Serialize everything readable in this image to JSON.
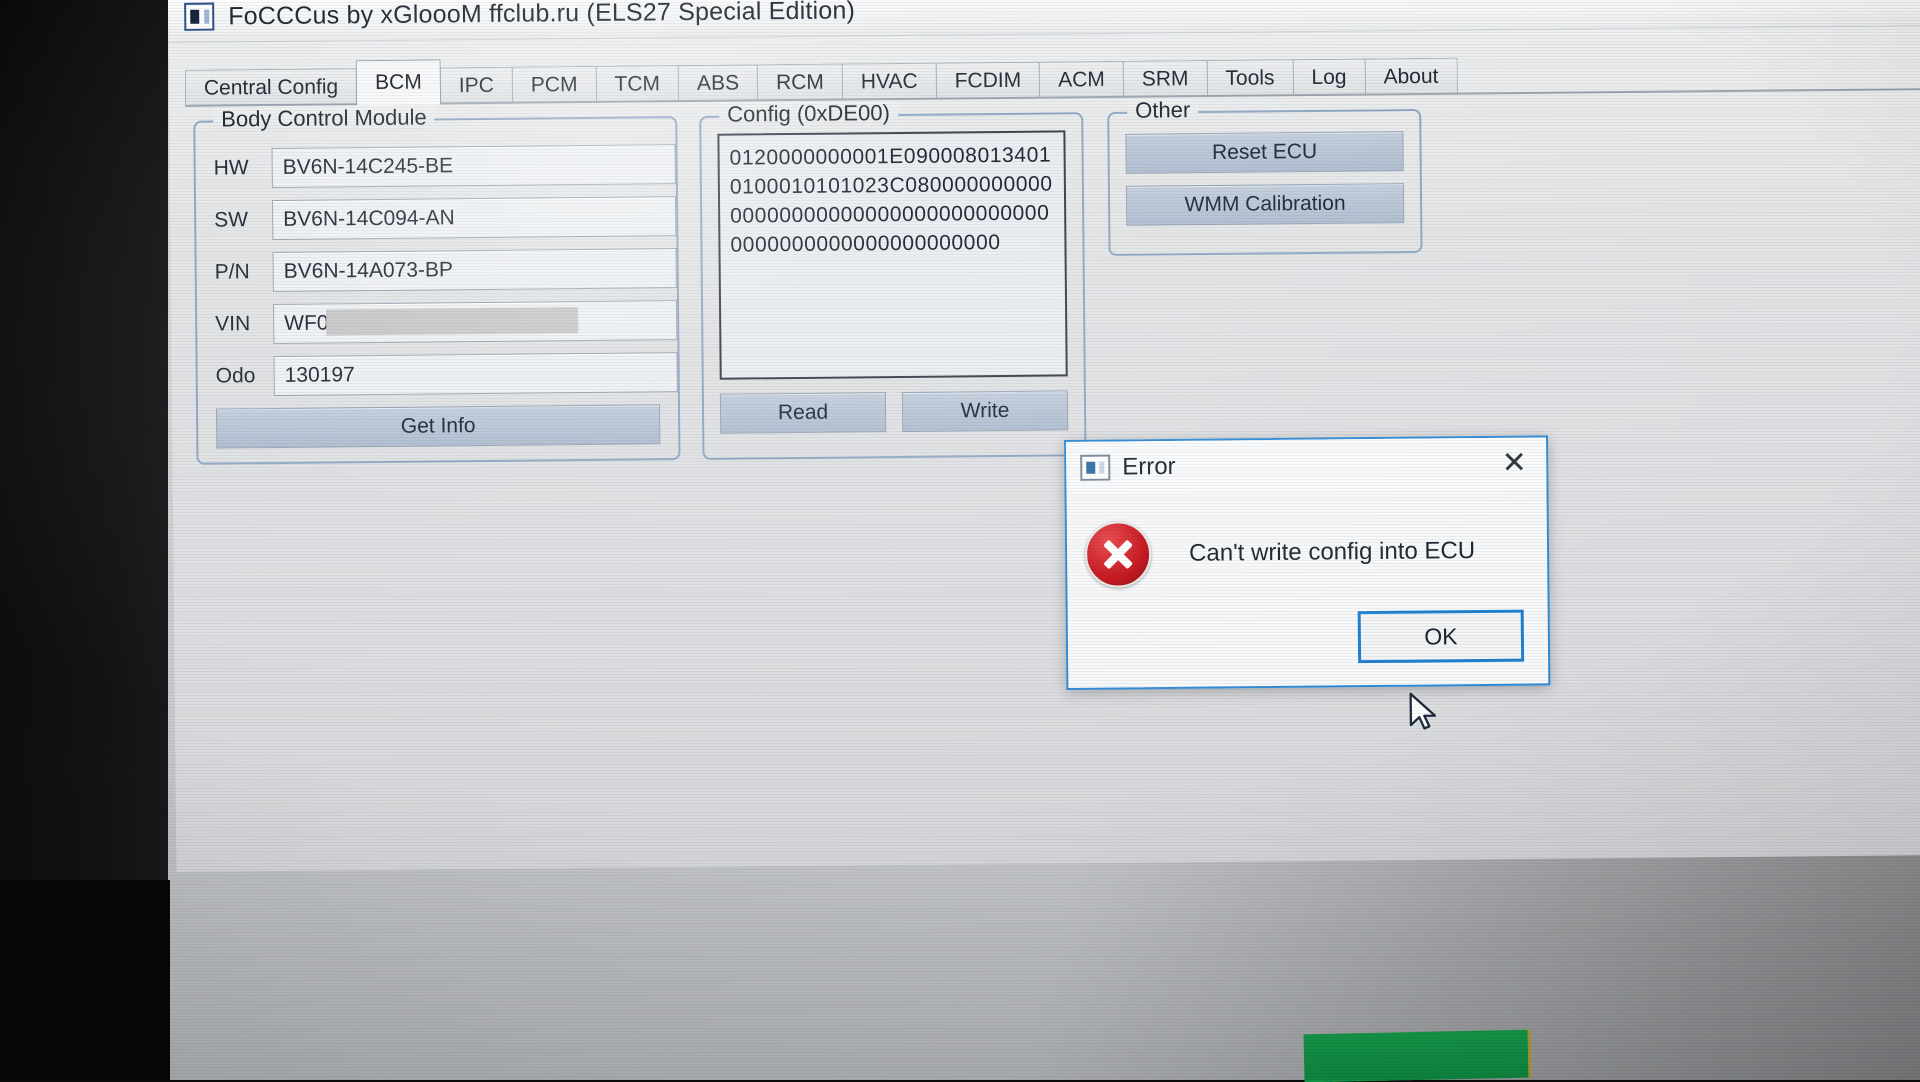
{
  "window": {
    "title": "FoCCCus by xGloooM ffclub.ru (ELS27 Special Edition)",
    "icon": "app-icon"
  },
  "tabs": [
    {
      "label": "Central Config",
      "active": false
    },
    {
      "label": "BCM",
      "active": true
    },
    {
      "label": "IPC",
      "active": false
    },
    {
      "label": "PCM",
      "active": false
    },
    {
      "label": "TCM",
      "active": false
    },
    {
      "label": "ABS",
      "active": false
    },
    {
      "label": "RCM",
      "active": false
    },
    {
      "label": "HVAC",
      "active": false
    },
    {
      "label": "FCDIM",
      "active": false
    },
    {
      "label": "ACM",
      "active": false
    },
    {
      "label": "SRM",
      "active": false
    },
    {
      "label": "Tools",
      "active": false
    },
    {
      "label": "Log",
      "active": false
    },
    {
      "label": "About",
      "active": false
    }
  ],
  "bcm": {
    "legend": "Body Control Module",
    "fields": [
      {
        "label": "HW",
        "value": "BV6N-14C245-BE",
        "redacted": false
      },
      {
        "label": "SW",
        "value": "BV6N-14C094-AN",
        "redacted": false
      },
      {
        "label": "P/N",
        "value": "BV6N-14A073-BP",
        "redacted": false
      },
      {
        "label": "VIN",
        "value": "WF0",
        "redacted": true
      },
      {
        "label": "Odo",
        "value": "130197",
        "redacted": false
      }
    ],
    "get_info_label": "Get Info"
  },
  "config": {
    "legend": "Config (0xDE00)",
    "hex_lines": [
      "0120000000001E090008013401",
      "0100010101023C080000000000",
      "00000000000000000000000000",
      "0000000000000000000000"
    ],
    "read_label": "Read",
    "write_label": "Write"
  },
  "other": {
    "legend": "Other",
    "reset_ecu_label": "Reset ECU",
    "wmm_calibration_label": "WMM Calibration"
  },
  "error_dialog": {
    "title": "Error",
    "message": "Can't write config into ECU",
    "ok_label": "OK",
    "close_icon": "✕",
    "icon": "error-cross-icon",
    "accent_color": "#1e7fd0",
    "error_color": "#c41018"
  }
}
